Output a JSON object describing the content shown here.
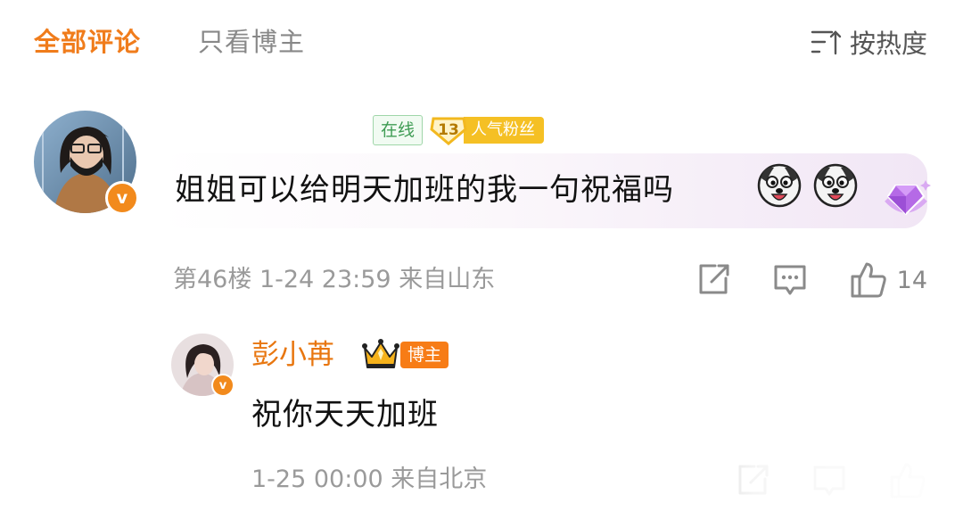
{
  "tabs": {
    "all_comments": "全部评论",
    "blogger_only": "只看博主",
    "sort_label": "按热度"
  },
  "comment": {
    "avatar": "user-avatar",
    "verified_badge": "v",
    "online_label": "在线",
    "fan_level": "13",
    "fan_label": "人气粉丝",
    "text": "姐姐可以给明天加班的我一句祝福吗",
    "meta": "第46楼 1-24 23:59 来自山东",
    "like_count": "14",
    "colors": {
      "bubble_end": "#f1e6f5",
      "accent": "#f07c1b"
    }
  },
  "reply": {
    "name": "彭小苒",
    "verified_badge": "v",
    "author_tag": "博主",
    "text": "祝你天天加班",
    "meta": "1-25 00:00 来自北京"
  },
  "icons": [
    "repost-icon",
    "comment-icon",
    "like-icon",
    "sort-icon",
    "crown-icon",
    "diamond-icon",
    "dog-emoji-icon"
  ]
}
